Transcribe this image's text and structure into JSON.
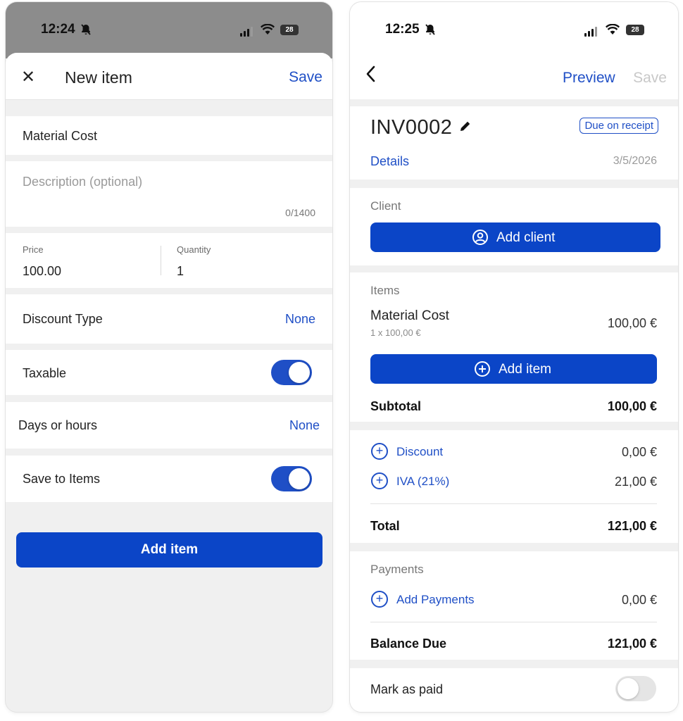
{
  "left": {
    "status": {
      "time": "12:24",
      "battery": "28"
    },
    "header": {
      "title": "New item",
      "save_label": "Save"
    },
    "fields": {
      "name_value": "Material Cost",
      "description_placeholder": "Description (optional)",
      "description_counter": "0/1400",
      "price_label": "Price",
      "price_value": "100.00",
      "quantity_label": "Quantity",
      "quantity_value": "1"
    },
    "rows": {
      "discount_type_label": "Discount Type",
      "discount_type_value": "None",
      "taxable_label": "Taxable",
      "taxable_on": true,
      "days_hours_label": "Days or hours",
      "days_hours_value": "None",
      "save_to_items_label": "Save to Items",
      "save_to_items_on": true
    },
    "add_item_button": "Add item"
  },
  "right": {
    "status": {
      "time": "12:25",
      "battery": "28"
    },
    "nav": {
      "preview_label": "Preview",
      "save_label": "Save"
    },
    "invoice": {
      "number": "INV0002",
      "due_badge": "Due on receipt",
      "details_link": "Details",
      "date": "3/5/2026"
    },
    "client": {
      "section_label": "Client",
      "add_client_button": "Add client"
    },
    "items": {
      "section_label": "Items",
      "list": [
        {
          "name": "Material Cost",
          "detail": "1 x 100,00 €",
          "amount": "100,00 €"
        }
      ],
      "add_item_button": "Add item",
      "subtotal_label": "Subtotal",
      "subtotal_value": "100,00 €"
    },
    "adjustments": {
      "discount_label": "Discount",
      "discount_value": "0,00 €",
      "tax_label": "IVA (21%)",
      "tax_value": "21,00 €",
      "total_label": "Total",
      "total_value": "121,00 €"
    },
    "payments": {
      "section_label": "Payments",
      "add_payments_label": "Add Payments",
      "add_payments_value": "0,00 €",
      "balance_label": "Balance Due",
      "balance_value": "121,00 €"
    },
    "mark_paid": {
      "label": "Mark as paid",
      "on": false
    }
  },
  "colors": {
    "accent": "#1f4fc6",
    "button": "#0b45c7",
    "background": "#f0f0f0",
    "statusbar_dim": "#8c8c8c"
  }
}
